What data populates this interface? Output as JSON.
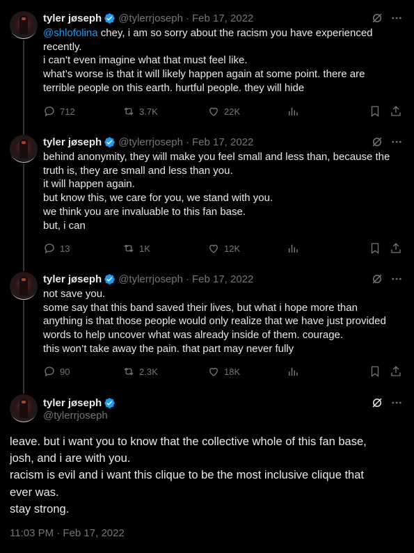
{
  "colors": {
    "background": "#000000",
    "text": "#e7e9ea",
    "muted": "#71767b",
    "accent": "#1d9bf0",
    "thread_line": "#333639"
  },
  "tweets": [
    {
      "display_name": "tyler jøseph",
      "handle": "@tylerrjoseph",
      "date": "Feb 17, 2022",
      "mention": "@shlofolina",
      "lines": [
        "chey, i am so sorry about the racism you have experienced",
        "recently.",
        "i can’t even imagine what that must feel like.",
        "what’s worse is that it will likely happen again at some point. there are",
        "terrible people on this earth. hurtful people. they will hide"
      ],
      "stats": {
        "replies": "712",
        "reposts": "3.7K",
        "likes": "22K"
      }
    },
    {
      "display_name": "tyler jøseph",
      "handle": "@tylerrjoseph",
      "date": "Feb 17, 2022",
      "lines": [
        "behind anonymity, they will make you feel small and less than, because the",
        "truth is, they are small and less than you.",
        "it will happen again.",
        "but know this, we care for you, we stand with you.",
        "we think you are invaluable to this fan base.",
        "but, i can"
      ],
      "stats": {
        "replies": "13",
        "reposts": "1K",
        "likes": "12K"
      }
    },
    {
      "display_name": "tyler jøseph",
      "handle": "@tylerrjoseph",
      "date": "Feb 17, 2022",
      "lines": [
        "not save you.",
        "some say that this band saved their lives, but what i hope more than",
        "anything is that those people would only realize that we have just provided",
        "words to help uncover what was already inside of them. courage.",
        "this won’t take away the pain. that part may never fully"
      ],
      "stats": {
        "replies": "90",
        "reposts": "2.3K",
        "likes": "18K"
      }
    }
  ],
  "main_tweet": {
    "display_name": "tyler jøseph",
    "handle": "@tylerrjoseph",
    "lines": [
      "leave. but i want you to know that the collective whole of this fan base,",
      "josh, and i are with you.",
      "racism is evil and i want this clique to be the most inclusive clique that",
      "ever was.",
      "stay strong."
    ],
    "timestamp": "11:03 PM · Feb 17, 2022"
  },
  "separator": "·",
  "icons": [
    "verified-badge-icon",
    "grok-icon",
    "more-icon",
    "reply-icon",
    "repost-icon",
    "like-icon",
    "views-icon",
    "bookmark-icon",
    "share-icon"
  ]
}
